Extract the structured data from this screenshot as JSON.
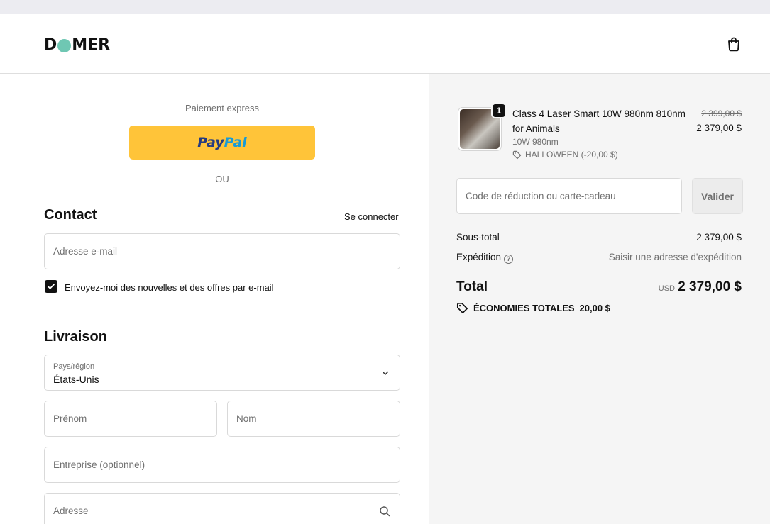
{
  "brand": {
    "logo_pre": "D",
    "logo_post": "MER",
    "accent": "#6fc7b3"
  },
  "header": {
    "cart_icon": "shopping-bag-icon"
  },
  "express": {
    "title": "Paiement express",
    "paypal_part1": "Pay",
    "paypal_part2": "Pal",
    "or_label": "OU"
  },
  "contact": {
    "title": "Contact",
    "login_link": "Se connecter",
    "email_placeholder": "Adresse e-mail",
    "newsletter_label": "Envoyez-moi des nouvelles et des offres par e-mail",
    "newsletter_checked": true
  },
  "delivery": {
    "title": "Livraison",
    "country_label": "Pays/région",
    "country_value": "États-Unis",
    "first_name_placeholder": "Prénom",
    "last_name_placeholder": "Nom",
    "company_placeholder": "Entreprise (optionnel)",
    "address_placeholder": "Adresse"
  },
  "summary": {
    "product": {
      "quantity": "1",
      "name": "Class 4 Laser Smart 10W 980nm 810nm for Animals",
      "variant": "10W 980nm",
      "discount": "HALLOWEEN (-20,00 $)",
      "price_old": "2 399,00 $",
      "price_new": "2 379,00 $"
    },
    "discount_placeholder": "Code de réduction ou carte-cadeau",
    "validate_label": "Valider",
    "subtotal_label": "Sous-total",
    "subtotal_value": "2 379,00 $",
    "shipping_label": "Expédition",
    "shipping_value": "Saisir une adresse d'expédition",
    "total_label": "Total",
    "currency": "USD",
    "total_value": "2 379,00 $",
    "savings_label": "ÉCONOMIES TOTALES",
    "savings_value": "20,00 $"
  }
}
